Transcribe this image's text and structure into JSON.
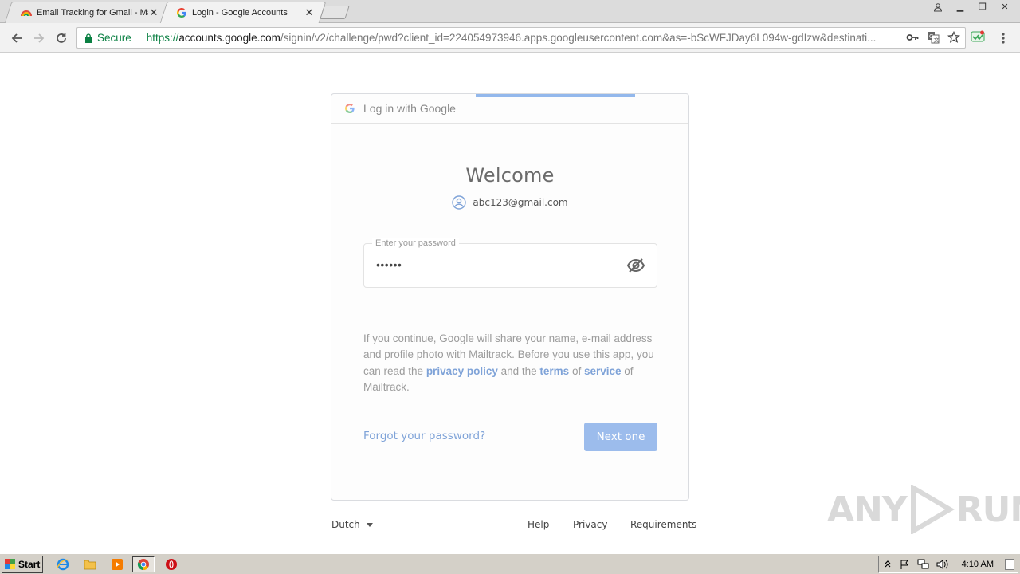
{
  "browser": {
    "tabs": [
      {
        "title": "Email Tracking for Gmail - Ma",
        "active": false
      },
      {
        "title": "Login - Google Accounts",
        "active": true
      }
    ],
    "secure_label": "Secure",
    "url": {
      "scheme": "https://",
      "host": "accounts.google.com",
      "path": "/signin/v2/challenge/pwd?client_id=224054973946.apps.googleusercontent.com&as=-bScWFJDay6L094w-gdIzw&destinati..."
    }
  },
  "card": {
    "header_title": "Log in with Google",
    "welcome": "Welcome",
    "account_email": "abc123@gmail.com",
    "password_label": "Enter your password",
    "password_value": "••••••",
    "disclosure": {
      "part1": "If you continue, Google will share your name, e-mail address and profile photo with Mailtrack. Before you use this app, you can read the ",
      "privacy_link": "privacy policy",
      "part2": " and the ",
      "terms_link_1": "terms",
      "part3": " of ",
      "terms_link_2": "service",
      "part4": " of Mailtrack."
    },
    "forgot_link": "Forgot your password?",
    "next_button": "Next one"
  },
  "footer": {
    "language": "Dutch",
    "links": [
      "Help",
      "Privacy",
      "Requirements"
    ]
  },
  "watermark": {
    "left": "ANY",
    "right": "RUN"
  },
  "taskbar": {
    "start_label": "Start",
    "clock": "4:10 AM"
  },
  "colors": {
    "accent_link": "#7fa3d8",
    "next_button": "#9cbcec",
    "secure_green": "#0b8043"
  }
}
